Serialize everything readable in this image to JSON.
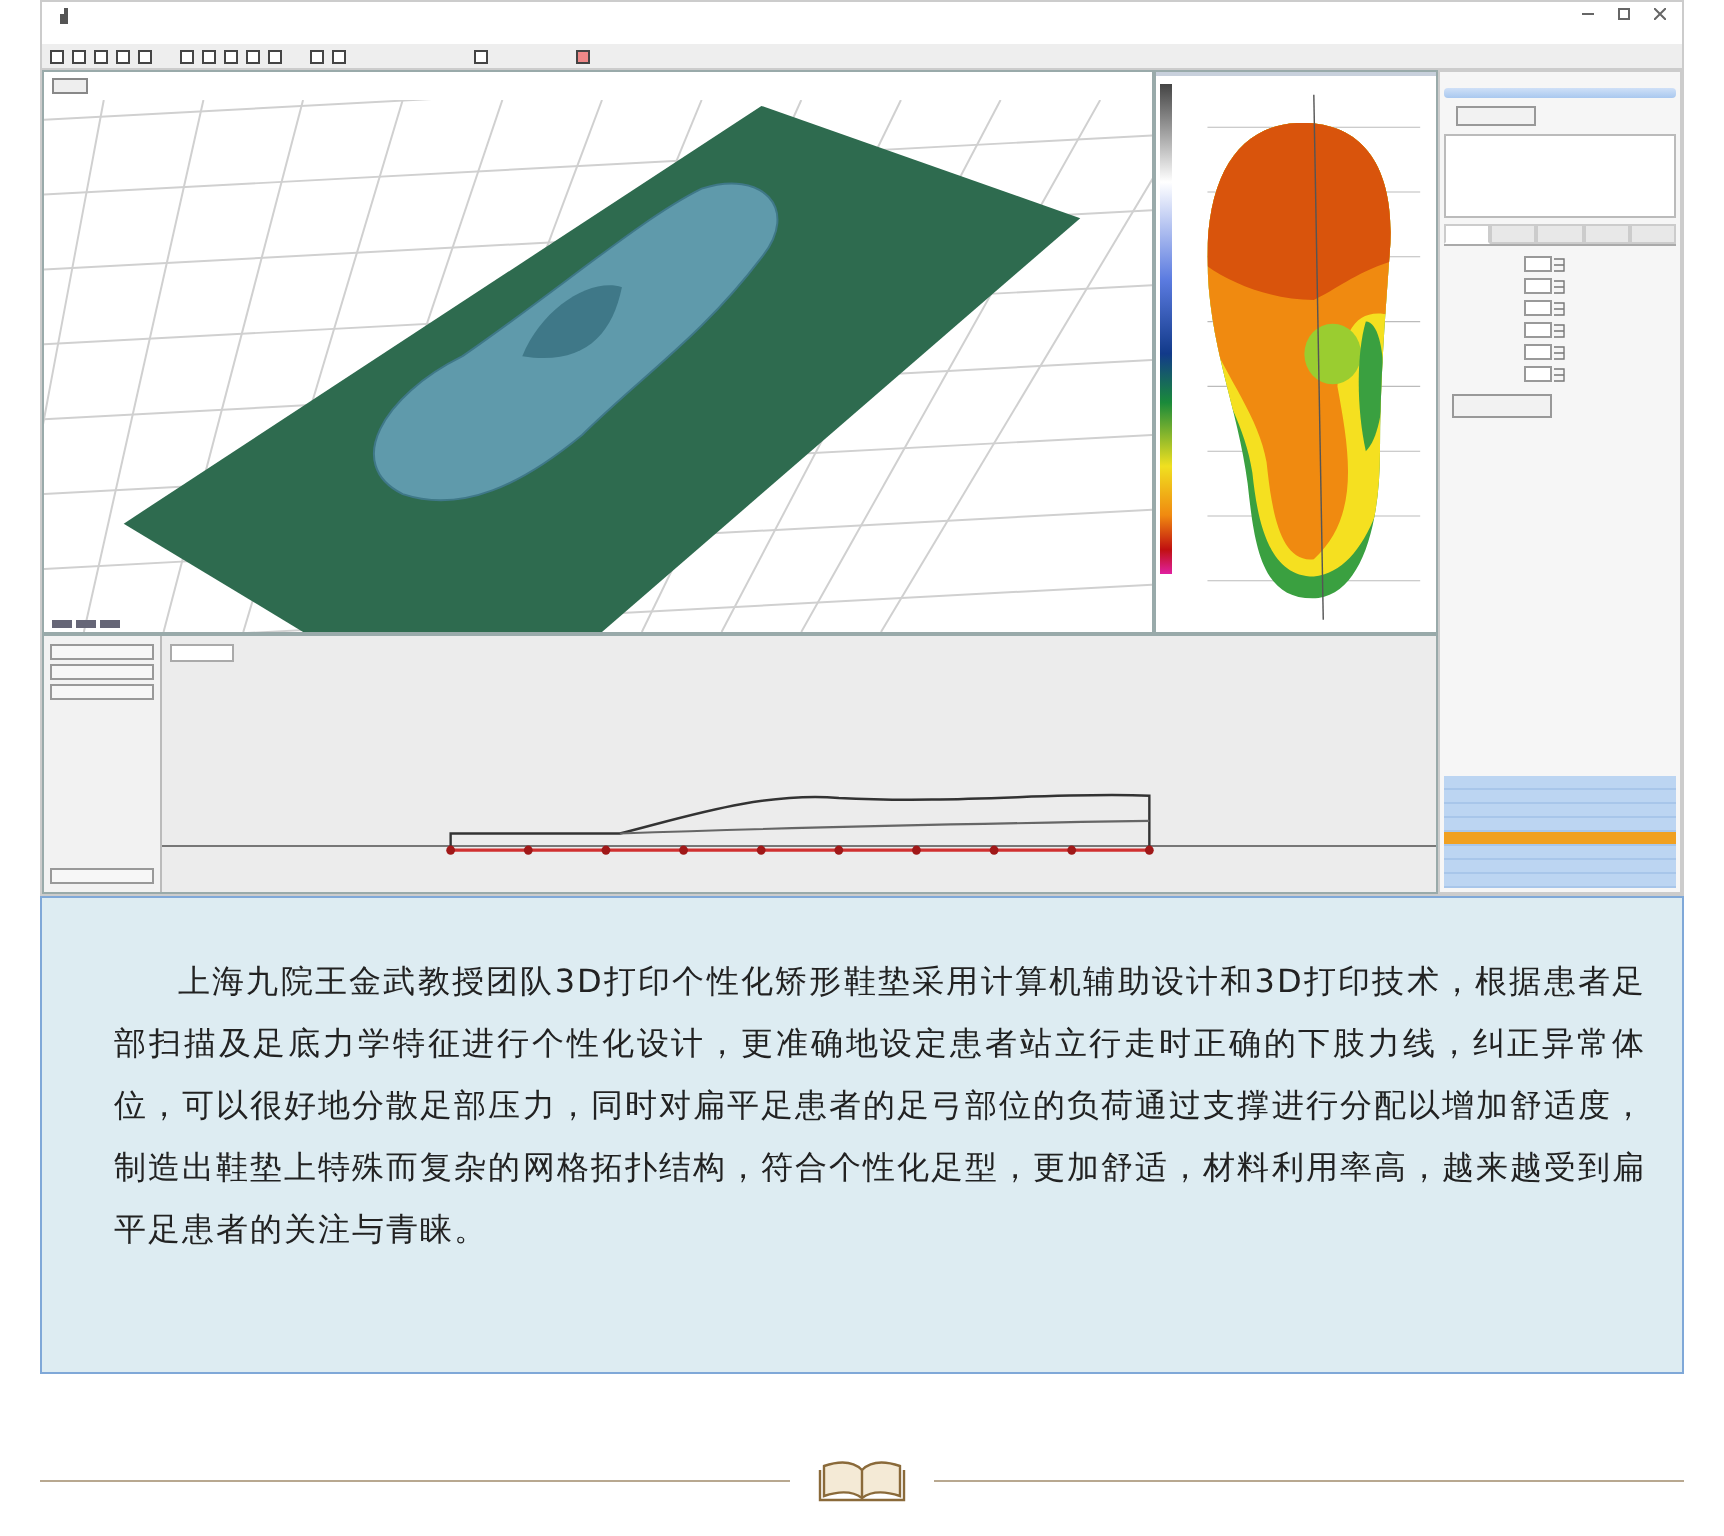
{
  "software": {
    "right_panel": {
      "tabs": [
        {
          "selected": true
        },
        {
          "selected": false
        },
        {
          "selected": false
        },
        {
          "selected": false
        },
        {
          "selected": false
        }
      ],
      "list_rows": [
        {
          "selected": false
        },
        {
          "selected": false
        },
        {
          "selected": false
        },
        {
          "selected": false
        },
        {
          "selected": true
        },
        {
          "selected": false
        },
        {
          "selected": false
        },
        {
          "selected": false
        }
      ]
    }
  },
  "article": {
    "paragraph": "上海九院王金武教授团队3D打印个性化矫形鞋垫采用计算机辅助设计和3D打印技术，根据患者足部扫描及足底力学特征进行个性化设计，更准确地设定患者站立行走时正确的下肢力线，纠正异常体位，可以很好地分散足部压力，同时对扁平足患者的足弓部位的负荷通过支撑进行分配以增加舒适度，制造出鞋垫上特殊而复杂的网格拓扑结构，符合个性化足型，更加舒适，材料利用率高，越来越受到扁平足患者的关注与青睐。"
  }
}
